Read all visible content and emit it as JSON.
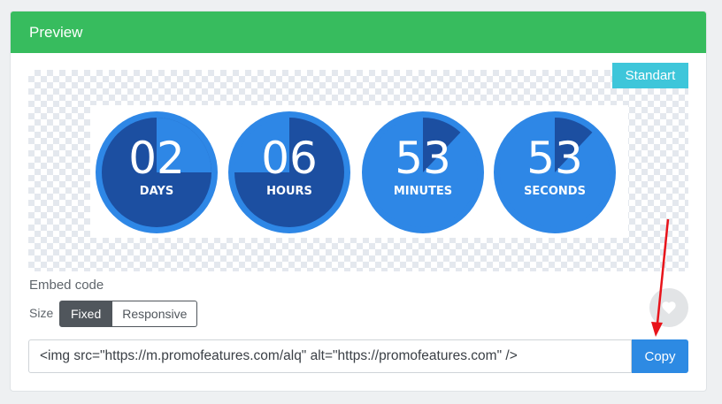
{
  "panel": {
    "title": "Preview"
  },
  "preview": {
    "badge": "Standart",
    "timer": [
      {
        "value": "02",
        "label": "DAYS",
        "progress": 0.25,
        "style": "dark"
      },
      {
        "value": "06",
        "label": "HOURS",
        "progress": 0.75,
        "style": "mid"
      },
      {
        "value": "53",
        "label": "MINUTES",
        "progress": 0.12,
        "style": "light"
      },
      {
        "value": "53",
        "label": "SECONDS",
        "progress": 0.12,
        "style": "light"
      }
    ]
  },
  "embed": {
    "label": "Embed code",
    "size_label": "Size",
    "size_options": {
      "fixed": "Fixed",
      "responsive": "Responsive"
    },
    "selected_size": "Fixed",
    "code": "<img src=\"https://m.promofeatures.com/alq\" alt=\"https://promofeatures.com\" />",
    "copy_label": "Copy"
  },
  "colors": {
    "header": "#37bc5e",
    "badge": "#3ec6da",
    "dial_ring": "#2e87e6",
    "dial_dark": "#1c4fa1",
    "dial_light": "#2e87e6",
    "copy_button": "#2d8ae3",
    "annotation_arrow": "#e8141b"
  },
  "icons": {
    "favorite": "heart-icon"
  }
}
